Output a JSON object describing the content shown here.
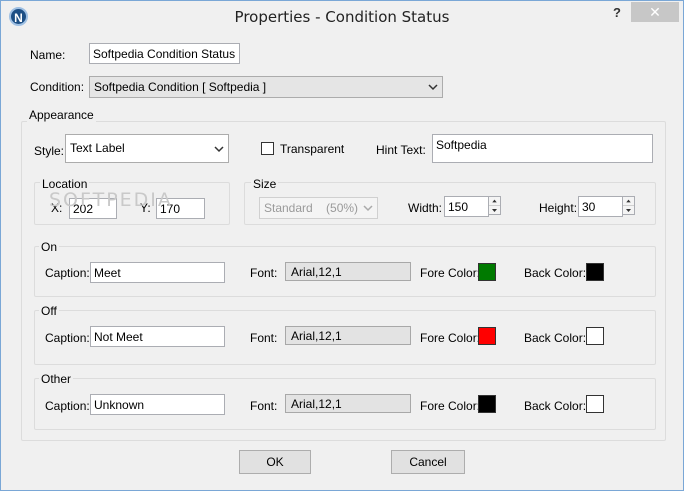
{
  "window": {
    "title": "Properties - Condition Status",
    "icon_letter": "N",
    "help_label": "?",
    "close_label": "✕"
  },
  "general": {
    "name_label": "Name:",
    "name_value": "Softpedia Condition Status",
    "condition_label": "Condition:",
    "condition_value": "Softpedia Condition [ Softpedia ]"
  },
  "appearance": {
    "group_label": "Appearance",
    "style_label": "Style:",
    "style_value": "Text Label",
    "transparent_label": "Transparent",
    "transparent_checked": false,
    "hint_label": "Hint Text:",
    "hint_value": "Softpedia"
  },
  "location": {
    "group_label": "Location",
    "x_label": "X:",
    "x_value": "202",
    "y_label": "Y:",
    "y_value": "170"
  },
  "size": {
    "group_label": "Size",
    "preset_value": "Standard    (50%)",
    "width_label": "Width:",
    "width_value": "150",
    "height_label": "Height:",
    "height_value": "30"
  },
  "states": [
    {
      "group_label": "On",
      "caption_label": "Caption:",
      "caption_value": "Meet",
      "font_label": "Font:",
      "font_value": "Arial,12,1",
      "fore_label": "Fore Color:",
      "fore_color": "#007a00",
      "back_label": "Back Color:",
      "back_color": "#000000"
    },
    {
      "group_label": "Off",
      "caption_label": "Caption:",
      "caption_value": "Not Meet",
      "font_label": "Font:",
      "font_value": "Arial,12,1",
      "fore_label": "Fore Color:",
      "fore_color": "#ff0000",
      "back_label": "Back Color:",
      "back_color": "#ffffff"
    },
    {
      "group_label": "Other",
      "caption_label": "Caption:",
      "caption_value": "Unknown",
      "font_label": "Font:",
      "font_value": "Arial,12,1",
      "fore_label": "Fore Color:",
      "fore_color": "#000000",
      "back_label": "Back Color:",
      "back_color": "#ffffff"
    }
  ],
  "buttons": {
    "ok_label": "OK",
    "cancel_label": "Cancel"
  },
  "watermark": "SOFTPEDIA"
}
